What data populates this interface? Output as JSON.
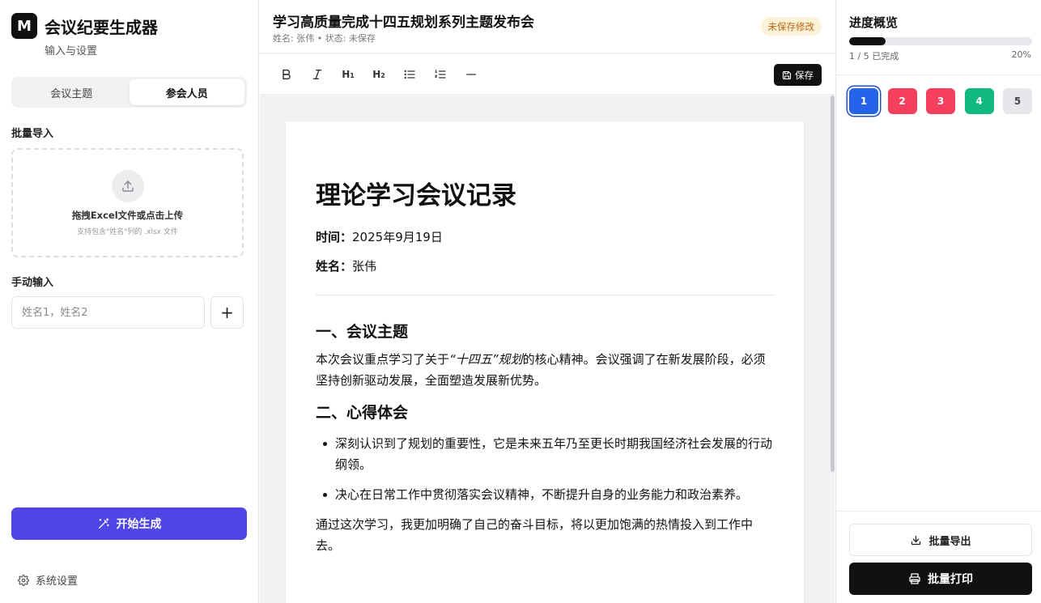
{
  "sidebar": {
    "logo_letter": "M",
    "app_title": "会议纪要生成器",
    "subtitle": "输入与设置",
    "tabs": [
      {
        "label": "会议主题",
        "active": false
      },
      {
        "label": "参会人员",
        "active": true
      }
    ],
    "bulk_import_label": "批量导入",
    "dropzone_title": "拖拽Excel文件或点击上传",
    "dropzone_hint": "支持包含\"姓名\"列的 .xlsx 文件",
    "manual_label": "手动输入",
    "name_input_placeholder": "姓名1，姓名2",
    "add_icon": "plus-icon",
    "generate_label": "开始生成",
    "settings_label": "系统设置"
  },
  "document": {
    "title": "学习高质量完成十四五规划系列主题发布会",
    "meta": "姓名: 张伟 • 状态: 未保存",
    "unsaved_badge": "未保存修改",
    "save_label": "保存",
    "toolbar": [
      "bold-icon",
      "italic-icon",
      "heading1-icon",
      "heading2-icon",
      "bullet-list-icon",
      "numbered-list-icon",
      "horizontal-rule-icon"
    ],
    "heading": "理论学习会议记录",
    "time_label": "时间：",
    "time_value": "2025年9月19日",
    "name_label": "姓名：",
    "name_value": "张伟",
    "section1_title": "一、会议主题",
    "section1_text_before": "本次会议重点学习了关于",
    "section1_text_italic": "“十四五”规划",
    "section1_text_after": "的核心精神。会议强调了在新发展阶段，必须坚持创新驱动发展，全面塑造发展新优势。",
    "section2_title": "二、心得体会",
    "bullets": [
      "深刻认识到了规划的重要性，它是未来五年乃至更长时期我国经济社会发展的行动纲领。",
      "决心在日常工作中贯彻落实会议精神，不断提升自身的业务能力和政治素养。"
    ],
    "closing": "通过这次学习，我更加明确了自己的奋斗目标，将以更加饱满的热情投入到工作中去。"
  },
  "progress": {
    "title": "进度概览",
    "completed_text": "1 / 5 已完成",
    "percent_text": "20%",
    "fraction": 0.2,
    "items": [
      {
        "label": "1",
        "color": "#2563eb",
        "selected": true
      },
      {
        "label": "2",
        "color": "#f43f5e",
        "selected": false
      },
      {
        "label": "3",
        "color": "#f43f5e",
        "selected": false
      },
      {
        "label": "4",
        "color": "#10b981",
        "selected": false
      },
      {
        "label": "5",
        "color": "#e5e7eb",
        "selected": false
      }
    ],
    "export_label": "批量导出",
    "print_label": "批量打印"
  }
}
